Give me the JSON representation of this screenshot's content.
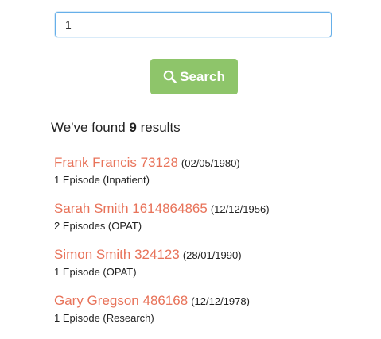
{
  "search": {
    "value": "1",
    "button_label": "Search"
  },
  "summary": {
    "prefix": "We've found",
    "count": "9",
    "suffix": "results"
  },
  "results": [
    {
      "name": "Frank Francis 73128",
      "dob": "(02/05/1980)",
      "episodes": "1 Episode (Inpatient)"
    },
    {
      "name": "Sarah Smith 1614864865",
      "dob": "(12/12/1956)",
      "episodes": "2 Episodes (OPAT)"
    },
    {
      "name": "Simon Smith 324123",
      "dob": "(28/01/1990)",
      "episodes": "1 Episode (OPAT)"
    },
    {
      "name": "Gary Gregson 486168",
      "dob": "(12/12/1978)",
      "episodes": "1 Episode (Research)"
    }
  ],
  "colors": {
    "accent_button": "#8ec56a",
    "link": "#e8735a",
    "focus_border": "#66afe9"
  },
  "icons": {
    "search_button": "search-icon"
  }
}
